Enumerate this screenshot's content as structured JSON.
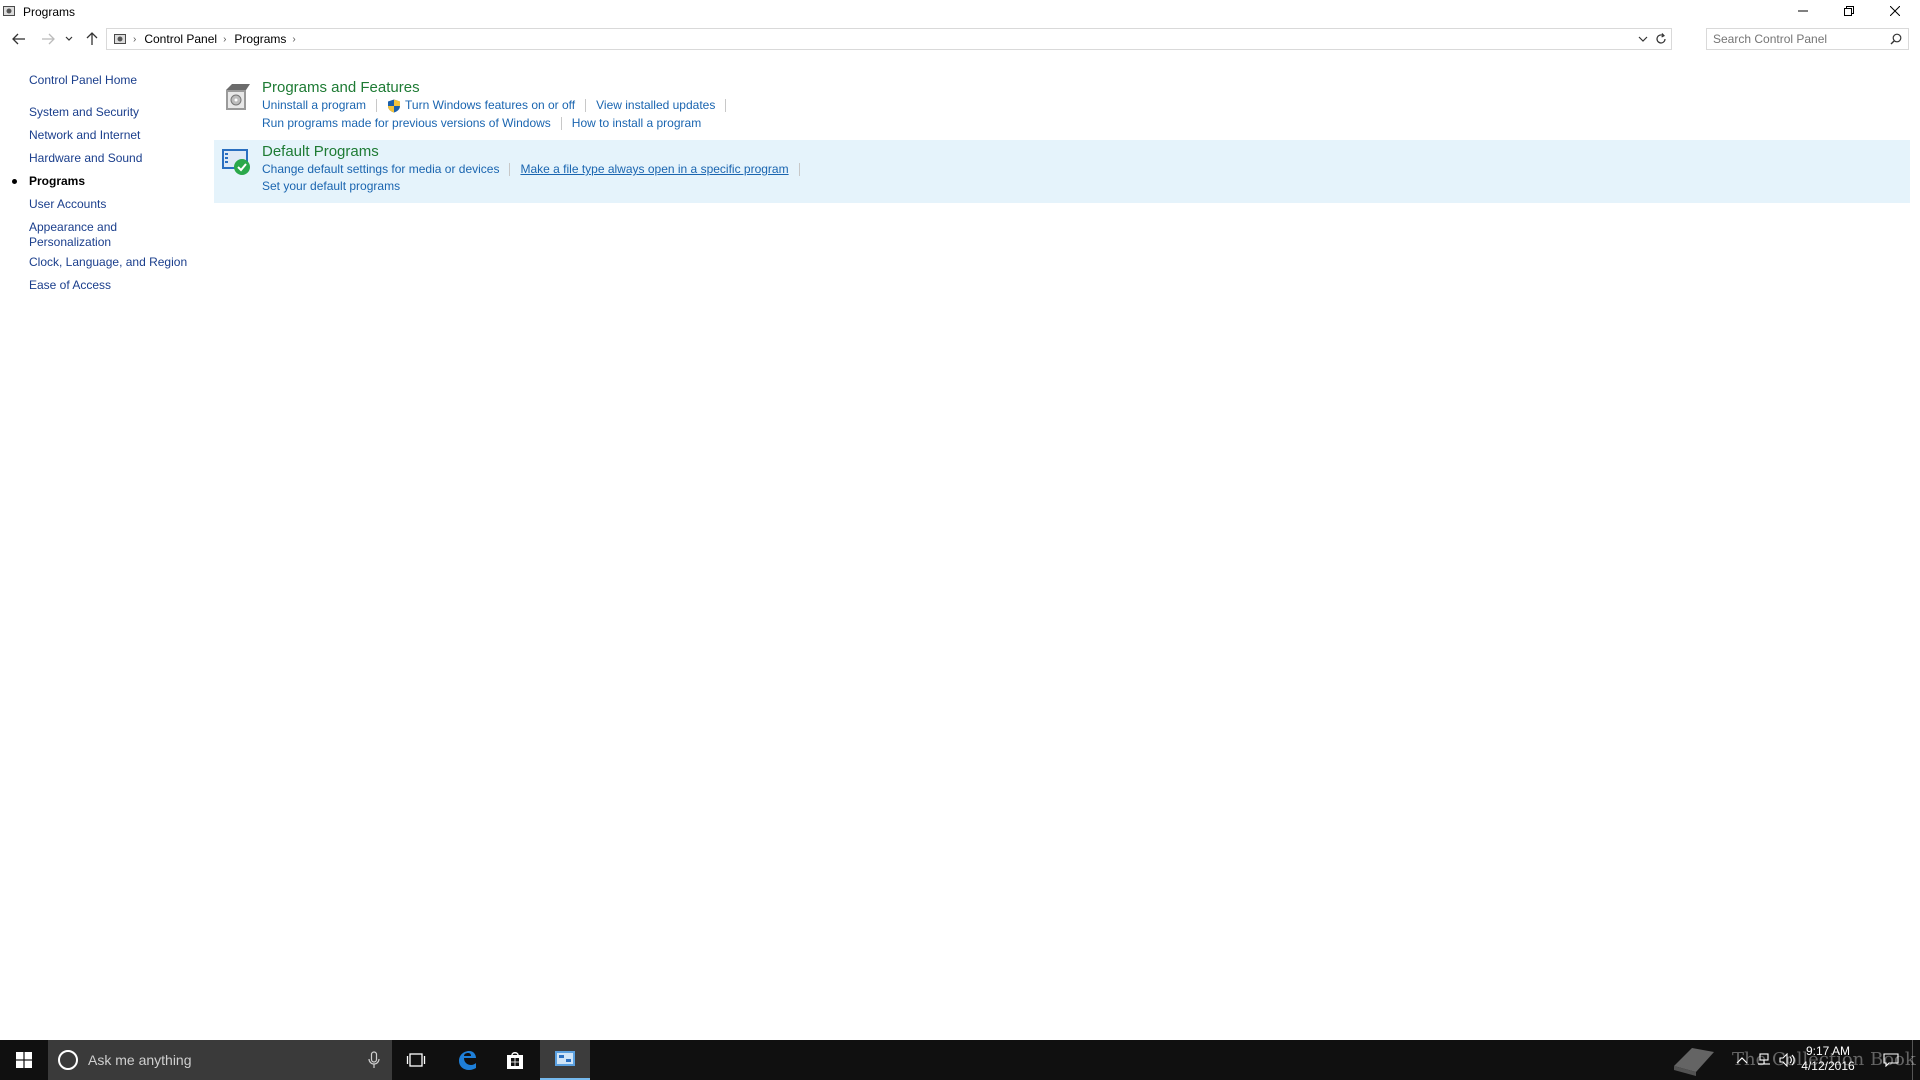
{
  "window": {
    "title": "Programs",
    "controls": {
      "minimize": "minimize-icon",
      "restore": "restore-icon",
      "close": "close-icon"
    }
  },
  "address": {
    "breadcrumbs": [
      "Control Panel",
      "Programs"
    ],
    "search_placeholder": "Search Control Panel"
  },
  "sidebar": {
    "home": "Control Panel Home",
    "items": [
      {
        "label": "System and Security"
      },
      {
        "label": "Network and Internet"
      },
      {
        "label": "Hardware and Sound"
      },
      {
        "label": "Programs",
        "current": true
      },
      {
        "label": "User Accounts"
      },
      {
        "label": "Appearance and",
        "label2": "Personalization"
      },
      {
        "label": "Clock, Language, and Region"
      },
      {
        "label": "Ease of Access"
      }
    ]
  },
  "categories": [
    {
      "title": "Programs and Features",
      "links_row1": [
        "Uninstall a program",
        "Turn Windows features on or off",
        "View installed updates"
      ],
      "links_row2": [
        "Run programs made for previous versions of Windows",
        "How to install a program"
      ]
    },
    {
      "title": "Default Programs",
      "links_row1": [
        "Change default settings for media or devices",
        "Make a file type always open in a specific program"
      ],
      "links_row2": [
        "Set your default programs"
      ]
    }
  ],
  "taskbar": {
    "search_placeholder": "Ask me anything",
    "time": "9:17 AM",
    "date": "4/12/2016",
    "active_color": "#76b9ed"
  },
  "watermark": "The Collection Book",
  "colors": {
    "link": "#1a65b0",
    "category_title": "#1e7b34",
    "highlight": "#e5f3fb"
  }
}
